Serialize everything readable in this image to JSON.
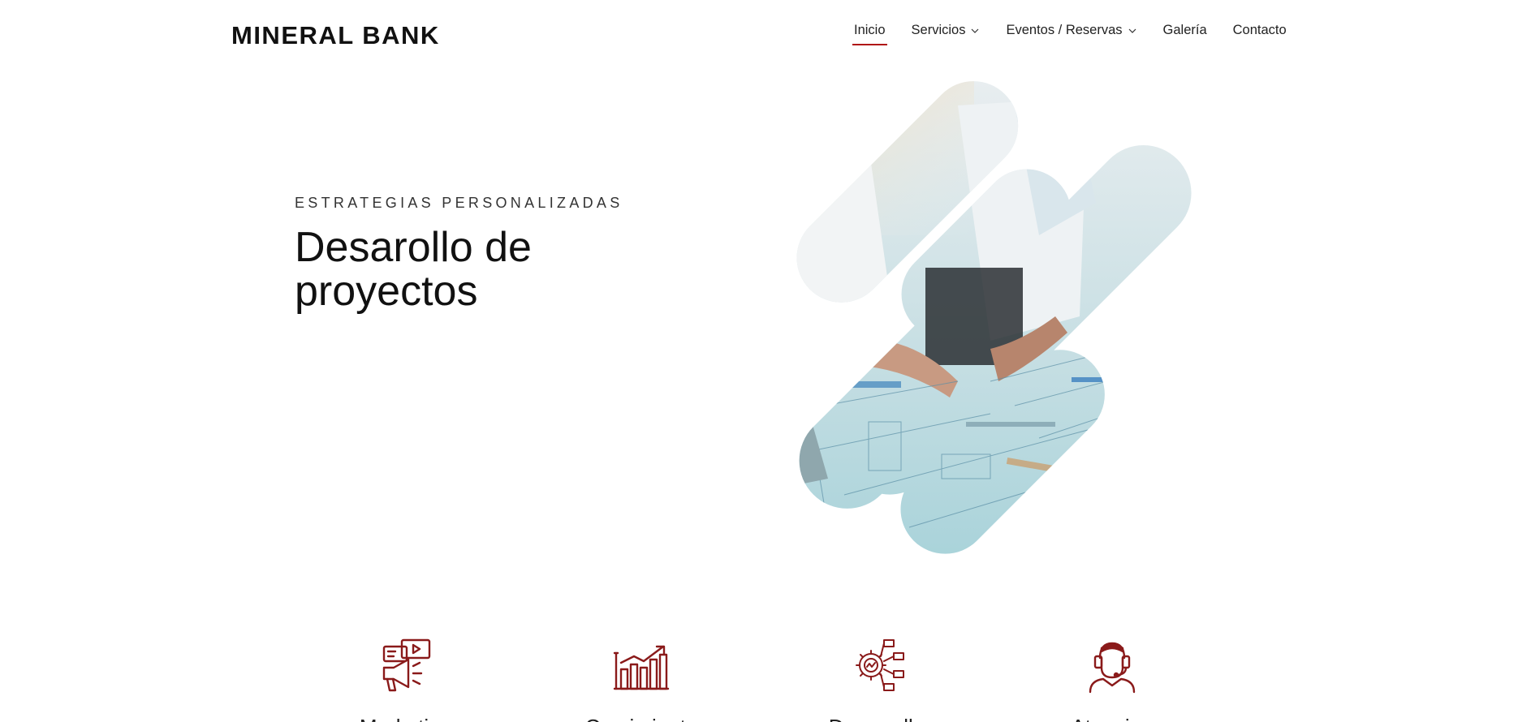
{
  "header": {
    "logo": "MINERAL BANK",
    "nav": [
      {
        "label": "Inicio",
        "active": true,
        "dropdown": false
      },
      {
        "label": "Servicios",
        "active": false,
        "dropdown": true
      },
      {
        "label": "Eventos / Reservas",
        "active": false,
        "dropdown": true
      },
      {
        "label": "Galería",
        "active": false,
        "dropdown": false
      },
      {
        "label": "Contacto",
        "active": false,
        "dropdown": false
      }
    ]
  },
  "hero": {
    "kicker": "ESTRATEGIAS PERSONALIZADAS",
    "title": "Desarollo de proyectos",
    "image": "team-planning-blueprints-photo"
  },
  "services": [
    {
      "label": "Marketing",
      "icon": "megaphone-video-icon"
    },
    {
      "label": "Crecimiento",
      "icon": "growth-chart-icon"
    },
    {
      "label": "Desarrollo",
      "icon": "gear-network-icon"
    },
    {
      "label": "Atencion",
      "icon": "headset-agent-icon"
    }
  ],
  "colors": {
    "accent": "#b01515",
    "icon": "#8a1a1a",
    "text": "#111111"
  }
}
